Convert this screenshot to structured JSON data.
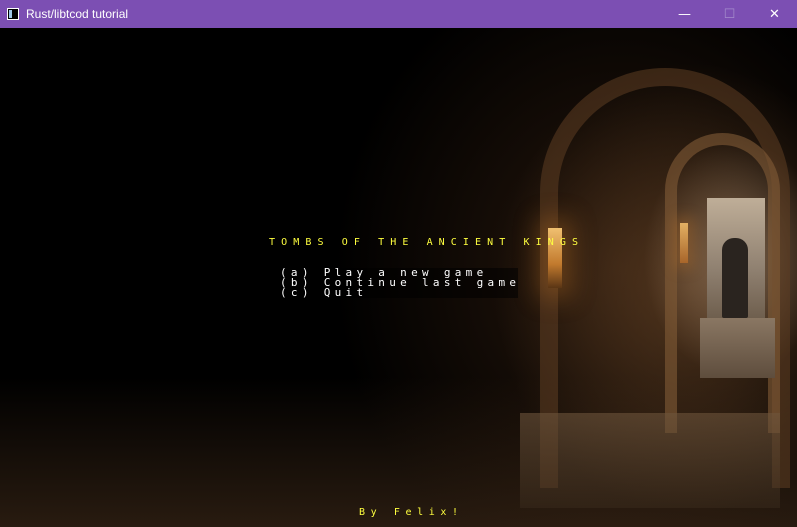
{
  "window": {
    "title": "Rust/libtcod tutorial",
    "minimize_glyph": "—",
    "maximize_glyph": "☐",
    "close_glyph": "✕"
  },
  "game": {
    "title": "TOMBS OF THE ANCIENT KINGS",
    "menu": {
      "items": [
        {
          "label": "(a) Play a new game"
        },
        {
          "label": "(b) Continue last game"
        },
        {
          "label": "(c) Quit"
        }
      ]
    },
    "credit": "By Felix!"
  },
  "colors": {
    "titlebar": "#7c4fb3",
    "title_text": "#ffff3f",
    "menu_text": "#ffffff",
    "background": "#000000"
  }
}
